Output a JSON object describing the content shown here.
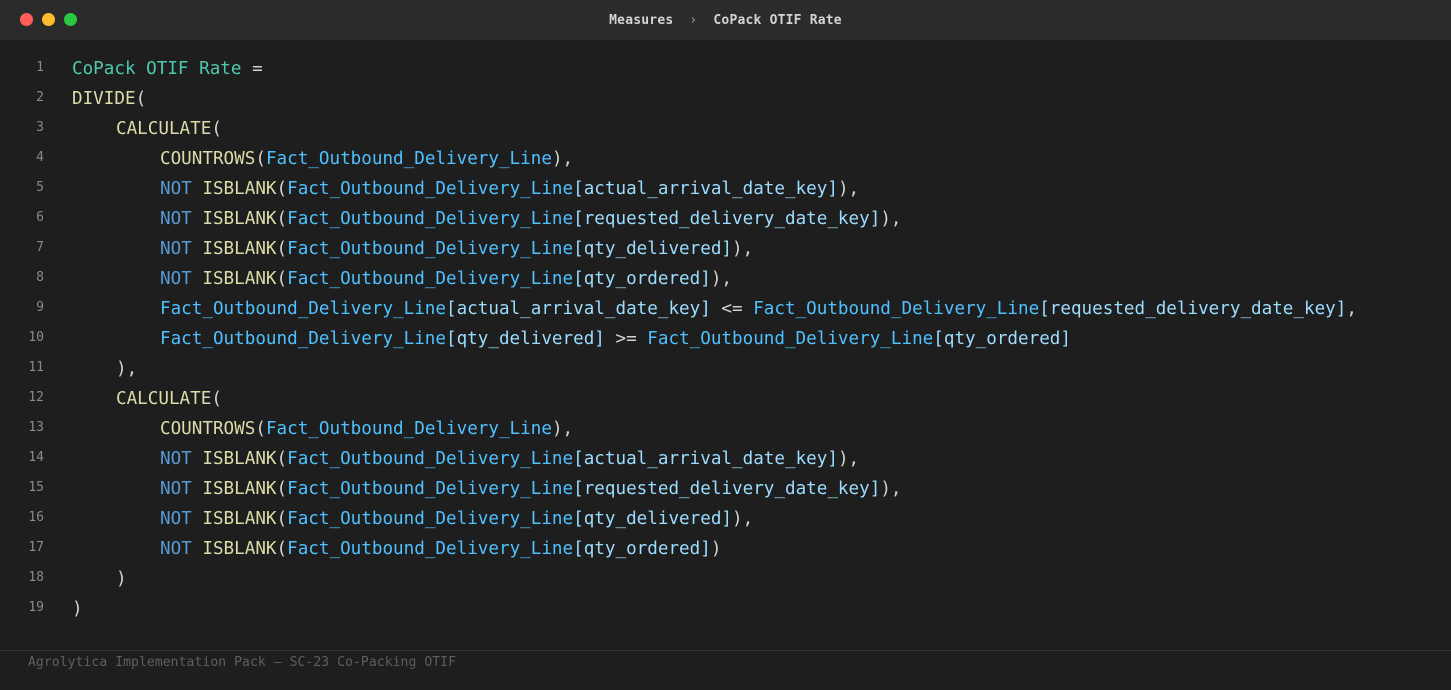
{
  "window": {
    "breadcrumb": [
      "Measures",
      "CoPack OTIF Rate"
    ],
    "separator": "›"
  },
  "theme": {
    "background": "#1e1e1e",
    "measure_name": "#4ec9b0",
    "function": "#dcdcaa",
    "keyword": "#569cd6",
    "table": "#4fc1ff",
    "column": "#9cdcfe"
  },
  "code_lines": [
    {
      "n": "1",
      "indent": 0,
      "tokens": [
        [
          "name",
          "CoPack OTIF Rate"
        ],
        [
          "op",
          " ="
        ]
      ]
    },
    {
      "n": "2",
      "indent": 0,
      "tokens": [
        [
          "fn",
          "DIVIDE"
        ],
        [
          "punc",
          "("
        ]
      ]
    },
    {
      "n": "3",
      "indent": 4,
      "tokens": [
        [
          "fn",
          "CALCULATE"
        ],
        [
          "punc",
          "("
        ]
      ]
    },
    {
      "n": "4",
      "indent": 8,
      "tokens": [
        [
          "fn",
          "COUNTROWS"
        ],
        [
          "punc",
          "("
        ],
        [
          "table",
          "Fact_Outbound_Delivery_Line"
        ],
        [
          "punc",
          "),"
        ]
      ]
    },
    {
      "n": "5",
      "indent": 8,
      "tokens": [
        [
          "kw",
          "NOT "
        ],
        [
          "fn",
          "ISBLANK"
        ],
        [
          "punc",
          "("
        ],
        [
          "table",
          "Fact_Outbound_Delivery_Line"
        ],
        [
          "col",
          "[actual_arrival_date_key]"
        ],
        [
          "punc",
          "),"
        ]
      ]
    },
    {
      "n": "6",
      "indent": 8,
      "tokens": [
        [
          "kw",
          "NOT "
        ],
        [
          "fn",
          "ISBLANK"
        ],
        [
          "punc",
          "("
        ],
        [
          "table",
          "Fact_Outbound_Delivery_Line"
        ],
        [
          "col",
          "[requested_delivery_date_key]"
        ],
        [
          "punc",
          "),"
        ]
      ]
    },
    {
      "n": "7",
      "indent": 8,
      "tokens": [
        [
          "kw",
          "NOT "
        ],
        [
          "fn",
          "ISBLANK"
        ],
        [
          "punc",
          "("
        ],
        [
          "table",
          "Fact_Outbound_Delivery_Line"
        ],
        [
          "col",
          "[qty_delivered]"
        ],
        [
          "punc",
          "),"
        ]
      ]
    },
    {
      "n": "8",
      "indent": 8,
      "tokens": [
        [
          "kw",
          "NOT "
        ],
        [
          "fn",
          "ISBLANK"
        ],
        [
          "punc",
          "("
        ],
        [
          "table",
          "Fact_Outbound_Delivery_Line"
        ],
        [
          "col",
          "[qty_ordered]"
        ],
        [
          "punc",
          "),"
        ]
      ]
    },
    {
      "n": "9",
      "indent": 8,
      "tokens": [
        [
          "table",
          "Fact_Outbound_Delivery_Line"
        ],
        [
          "col",
          "[actual_arrival_date_key]"
        ],
        [
          "op",
          " <= "
        ],
        [
          "table",
          "Fact_Outbound_Delivery_Line"
        ],
        [
          "col",
          "[requested_delivery_date_key]"
        ],
        [
          "punc",
          ","
        ]
      ]
    },
    {
      "n": "10",
      "indent": 8,
      "tokens": [
        [
          "table",
          "Fact_Outbound_Delivery_Line"
        ],
        [
          "col",
          "[qty_delivered]"
        ],
        [
          "op",
          " >= "
        ],
        [
          "table",
          "Fact_Outbound_Delivery_Line"
        ],
        [
          "col",
          "[qty_ordered]"
        ]
      ]
    },
    {
      "n": "11",
      "indent": 4,
      "tokens": [
        [
          "punc",
          "),"
        ]
      ]
    },
    {
      "n": "12",
      "indent": 4,
      "tokens": [
        [
          "fn",
          "CALCULATE"
        ],
        [
          "punc",
          "("
        ]
      ]
    },
    {
      "n": "13",
      "indent": 8,
      "tokens": [
        [
          "fn",
          "COUNTROWS"
        ],
        [
          "punc",
          "("
        ],
        [
          "table",
          "Fact_Outbound_Delivery_Line"
        ],
        [
          "punc",
          "),"
        ]
      ]
    },
    {
      "n": "14",
      "indent": 8,
      "tokens": [
        [
          "kw",
          "NOT "
        ],
        [
          "fn",
          "ISBLANK"
        ],
        [
          "punc",
          "("
        ],
        [
          "table",
          "Fact_Outbound_Delivery_Line"
        ],
        [
          "col",
          "[actual_arrival_date_key]"
        ],
        [
          "punc",
          "),"
        ]
      ]
    },
    {
      "n": "15",
      "indent": 8,
      "tokens": [
        [
          "kw",
          "NOT "
        ],
        [
          "fn",
          "ISBLANK"
        ],
        [
          "punc",
          "("
        ],
        [
          "table",
          "Fact_Outbound_Delivery_Line"
        ],
        [
          "col",
          "[requested_delivery_date_key]"
        ],
        [
          "punc",
          "),"
        ]
      ]
    },
    {
      "n": "16",
      "indent": 8,
      "tokens": [
        [
          "kw",
          "NOT "
        ],
        [
          "fn",
          "ISBLANK"
        ],
        [
          "punc",
          "("
        ],
        [
          "table",
          "Fact_Outbound_Delivery_Line"
        ],
        [
          "col",
          "[qty_delivered]"
        ],
        [
          "punc",
          "),"
        ]
      ]
    },
    {
      "n": "17",
      "indent": 8,
      "tokens": [
        [
          "kw",
          "NOT "
        ],
        [
          "fn",
          "ISBLANK"
        ],
        [
          "punc",
          "("
        ],
        [
          "table",
          "Fact_Outbound_Delivery_Line"
        ],
        [
          "col",
          "[qty_ordered]"
        ],
        [
          "punc",
          ")"
        ]
      ]
    },
    {
      "n": "18",
      "indent": 4,
      "tokens": [
        [
          "punc",
          ")"
        ]
      ]
    },
    {
      "n": "19",
      "indent": 0,
      "tokens": [
        [
          "punc",
          ")"
        ]
      ]
    }
  ],
  "footer": {
    "text": "Agrolytica Implementation Pack — SC-23 Co-Packing OTIF"
  }
}
